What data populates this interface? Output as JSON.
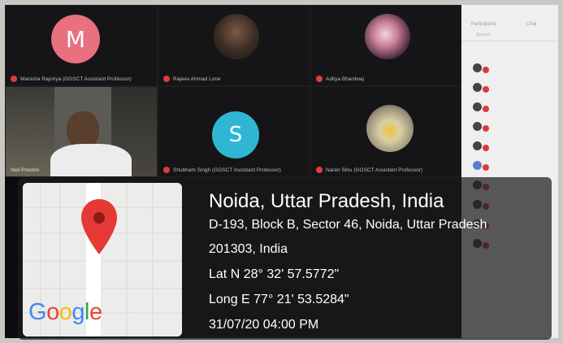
{
  "meeting": {
    "tiles": [
      {
        "id": "t1",
        "avatar_letter": "M",
        "name": "Manisha Rajoriya (GGSCT Assistant Professor)"
      },
      {
        "id": "t2",
        "name": "Rajeev Ahmad Lone"
      },
      {
        "id": "t3",
        "name": "Aditya Bhardwaj"
      },
      {
        "id": "t4",
        "name": "Neil Preston"
      },
      {
        "id": "t5",
        "avatar_letter": "S",
        "name": "Shubham Singh (GGSCT Assistant Professor)"
      },
      {
        "id": "t6",
        "name": "Naren Sihu (GGSCT Assistant Professor)"
      }
    ],
    "colors": {
      "avatar_m": "#e8707f",
      "avatar_s": "#2fb6d4",
      "mic_off": "#e23b3b"
    }
  },
  "participants_panel": {
    "tab_participants": "Participants",
    "tab_chat": "Chat",
    "search_placeholder": "Search",
    "items": [
      "",
      "",
      "",
      "",
      "",
      "",
      "",
      "",
      "",
      ""
    ]
  },
  "geotag": {
    "city": "Noida, Uttar Pradesh, India",
    "address_line1": "D-193, Block B, Sector 46, Noida, Uttar Pradesh",
    "address_line2": "201303, India",
    "latitude": "Lat N 28° 32' 57.5772\"",
    "longitude": "Long E 77° 21' 53.5284\"",
    "datetime": "31/07/20 04:00 PM",
    "map_logo": "Google",
    "pin_color": "#e53935"
  }
}
